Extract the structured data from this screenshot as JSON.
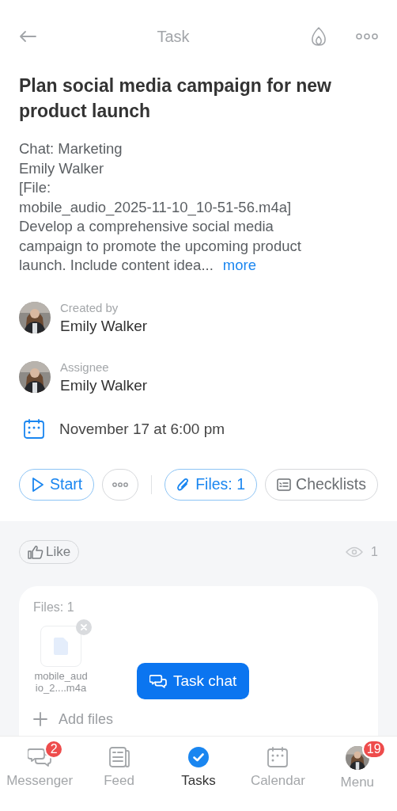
{
  "header": {
    "title": "Task"
  },
  "task": {
    "title": "Plan social media campaign for new product launch",
    "description": "Chat: Marketing\nEmily Walker\n[File:\nmobile_audio_2025-11-10_10-51-56.m4a]\nDevelop a comprehensive social media\ncampaign to promote the upcoming product\nlaunch. Include content idea...",
    "more_link": "more"
  },
  "people": [
    {
      "role": "Created by",
      "name": "Emily Walker"
    },
    {
      "role": "Assignee",
      "name": "Emily Walker"
    }
  ],
  "deadline": "November 17 at 6:00 pm",
  "actions": [
    {
      "kind": "start",
      "label": "Start"
    },
    {
      "kind": "more"
    },
    {
      "kind": "files",
      "label": "Files: 1"
    },
    {
      "kind": "checklists",
      "label": "Checklists"
    }
  ],
  "like": {
    "label": "Like"
  },
  "views": "1",
  "files_card": {
    "title": "Files: 1",
    "files": [
      {
        "name": "mobile_aud\nio_2....m4a"
      }
    ],
    "add_label": "Add files"
  },
  "task_chat": {
    "label": "Task chat"
  },
  "tabs": [
    {
      "kind": "messenger",
      "label": "Messenger",
      "badge": "2",
      "selected": false
    },
    {
      "kind": "feed",
      "label": "Feed",
      "selected": false
    },
    {
      "kind": "tasks",
      "label": "Tasks",
      "selected": true
    },
    {
      "kind": "calendar",
      "label": "Calendar",
      "selected": false
    },
    {
      "kind": "menu",
      "label": "Menu",
      "badge": "19",
      "selected": false
    }
  ]
}
